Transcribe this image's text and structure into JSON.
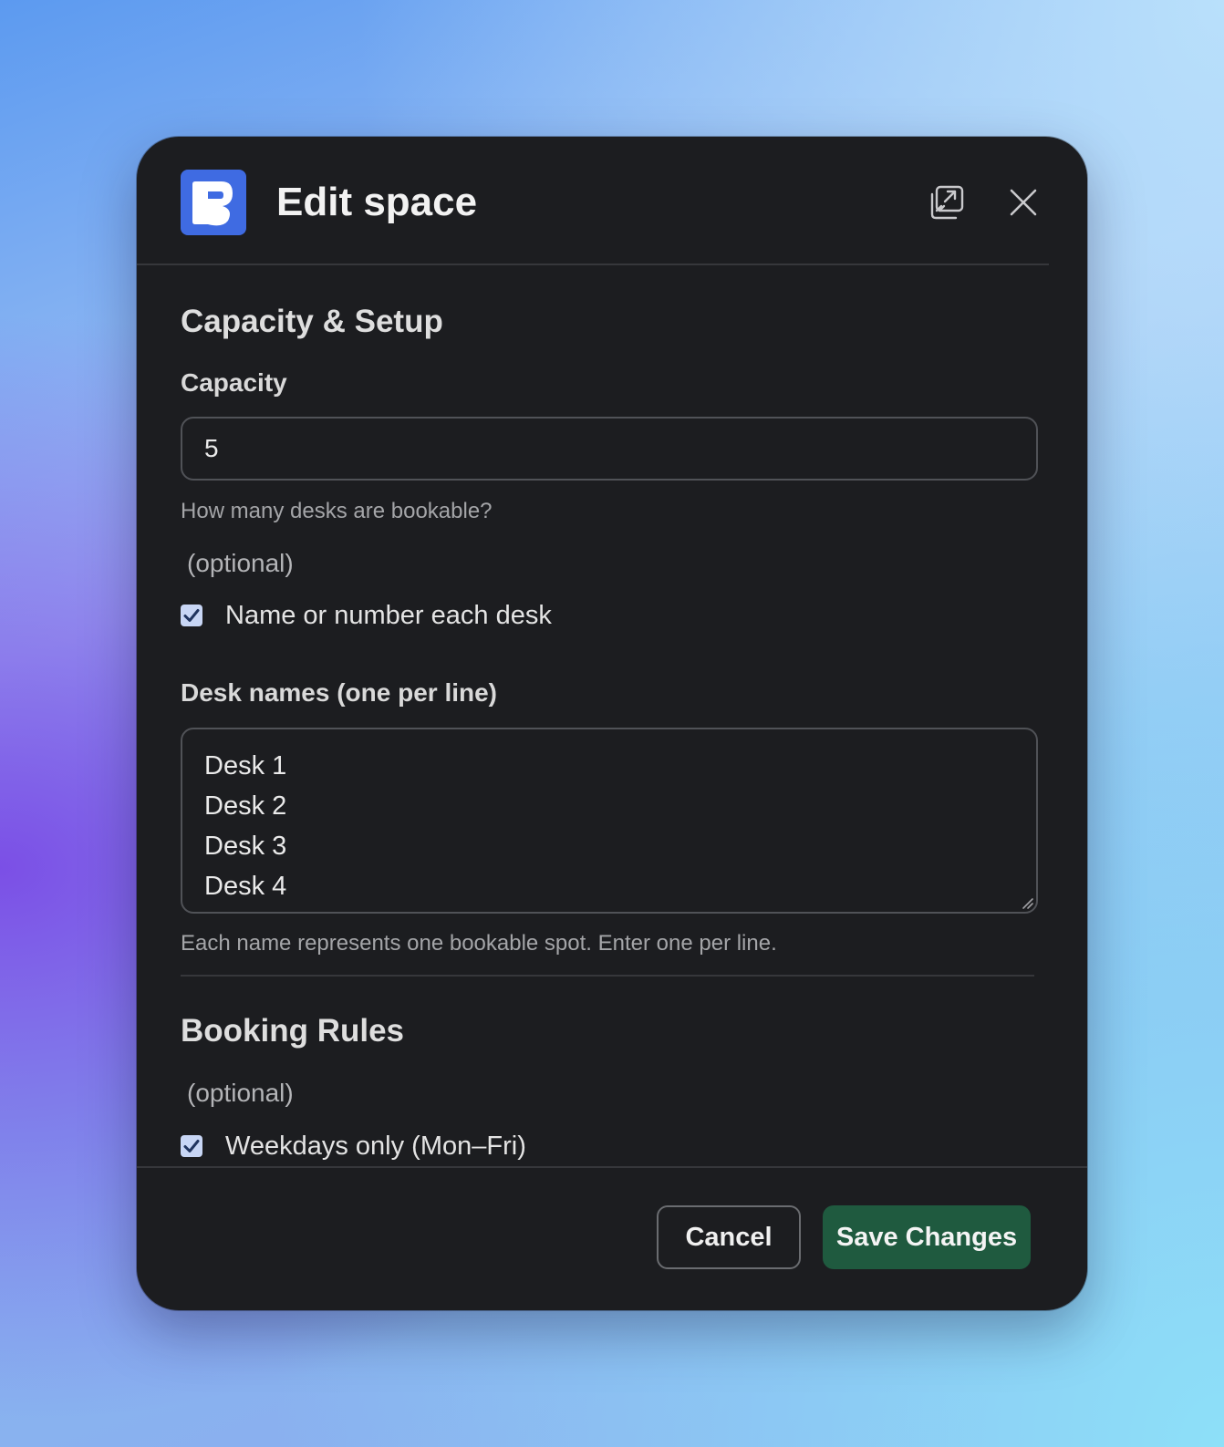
{
  "dialog": {
    "title": "Edit space",
    "logo": "app-logo-icon",
    "header_icons": [
      "popout-icon",
      "close-icon"
    ]
  },
  "capacity_section": {
    "title": "Capacity & Setup",
    "capacity_label": "Capacity",
    "capacity_value": "5",
    "capacity_hint": "How many desks are bookable?",
    "optional_label": "(optional)",
    "name_desks_label": "Name or number each desk",
    "name_desks_checked": true,
    "desk_names_label": "Desk names (one per line)",
    "desk_names": [
      "Desk 1",
      "Desk 2",
      "Desk 3",
      "Desk 4"
    ],
    "desk_names_hint": "Each name represents one bookable spot. Enter one per line."
  },
  "booking_section": {
    "title": "Booking Rules",
    "optional_label": "(optional)",
    "weekdays_label": "Weekdays only (Mon–Fri)",
    "weekdays_checked": true
  },
  "footer": {
    "cancel_label": "Cancel",
    "save_label": "Save Changes"
  },
  "colors": {
    "modal_bg": "#1c1d20",
    "logo_blue": "#3f6be2",
    "save_green": "#1f5a3f",
    "checkbox_fill": "#c8d6f5"
  }
}
